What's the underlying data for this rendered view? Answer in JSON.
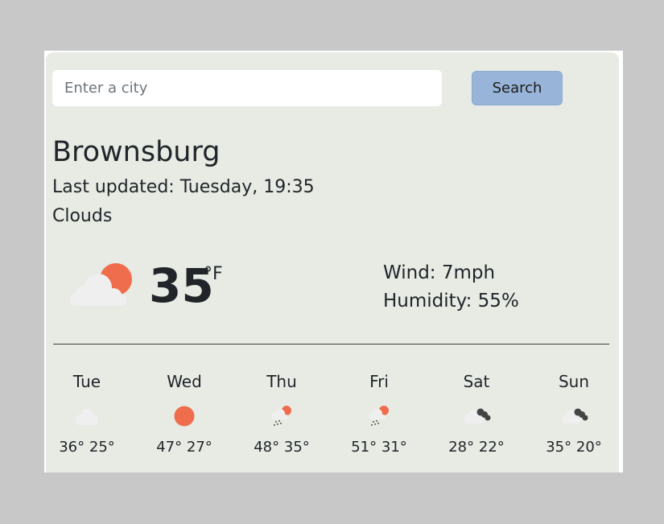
{
  "search": {
    "placeholder": "Enter a city",
    "value": "",
    "button_label": "Search"
  },
  "current": {
    "city": "Brownsburg",
    "last_updated": "Last updated: Tuesday, 19:35",
    "description": "Clouds",
    "temperature": "35",
    "unit": "°F",
    "icon": "cloud-sun-icon",
    "wind": "Wind: 7mph",
    "humidity": "Humidity: 55%"
  },
  "forecast": [
    {
      "day": "Tue",
      "temps": "36° 25°",
      "icon": "cloud-icon"
    },
    {
      "day": "Wed",
      "temps": "47° 27°",
      "icon": "sun-icon"
    },
    {
      "day": "Thu",
      "temps": "48° 35°",
      "icon": "rain-sun-icon"
    },
    {
      "day": "Fri",
      "temps": "51° 31°",
      "icon": "rain-sun-icon"
    },
    {
      "day": "Sat",
      "temps": "28° 22°",
      "icon": "cloudy-dark-icon"
    },
    {
      "day": "Sun",
      "temps": "35° 20°",
      "icon": "cloudy-dark-icon"
    }
  ],
  "colors": {
    "page_background": "#c8c8c8",
    "card_background": "#e7ebe4",
    "button_background": "#98b4d8",
    "sun": "#ef6c4c",
    "cloud": "#efefef",
    "dark_cloud": "#444444",
    "text": "#212529"
  }
}
